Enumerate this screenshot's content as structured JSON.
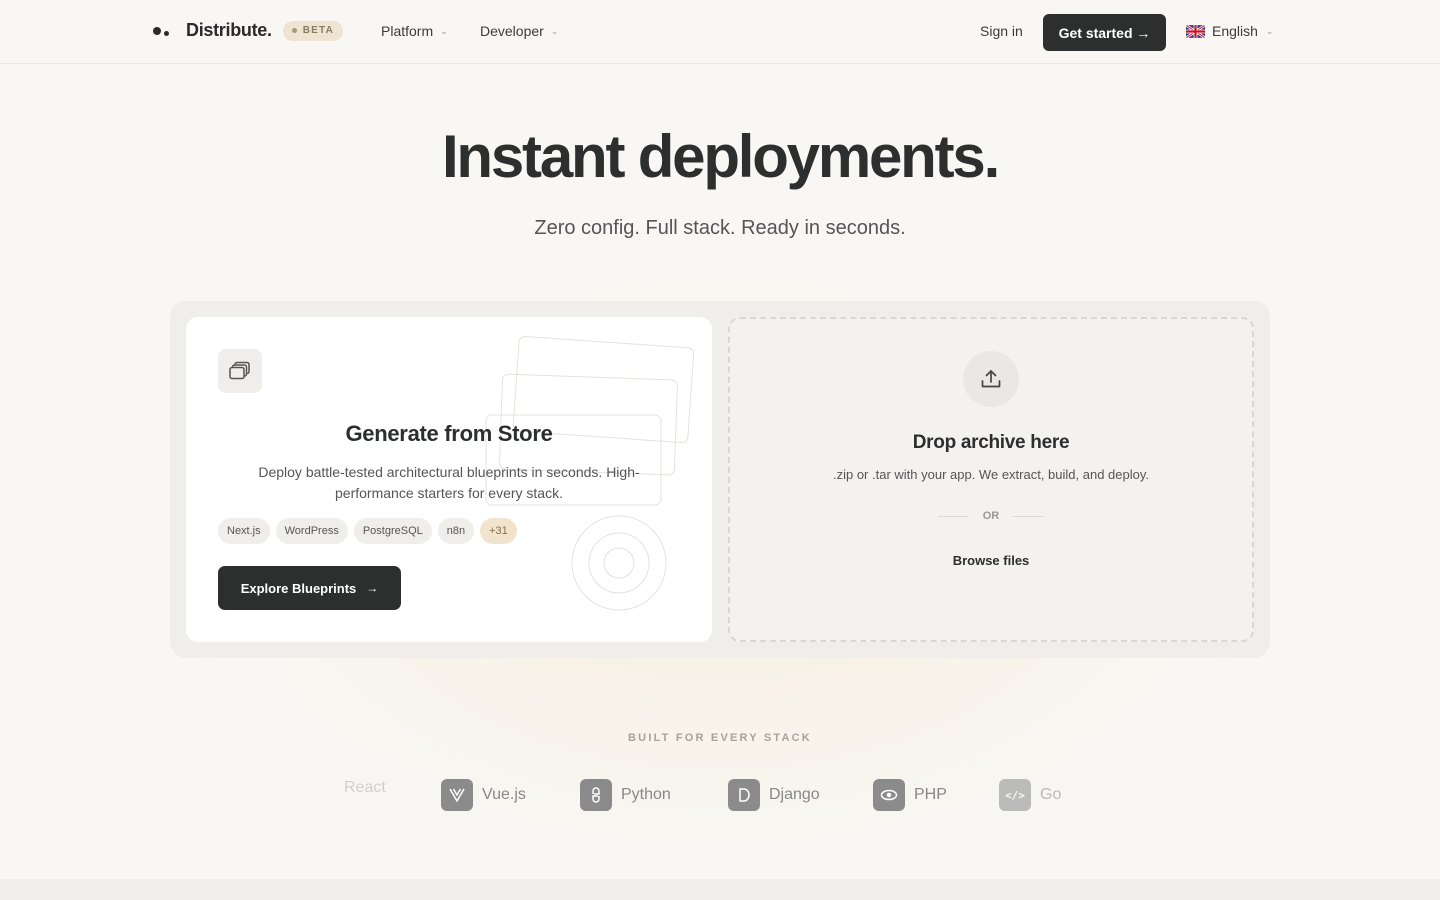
{
  "header": {
    "brand_name": "Distribute.",
    "beta_label": "BETA",
    "nav": [
      {
        "label": "Platform"
      },
      {
        "label": "Developer"
      }
    ],
    "sign_in": "Sign in",
    "get_started": "Get started →",
    "language": "English",
    "icons": {
      "logo": "distribute-logo",
      "flag": "uk-flag-icon",
      "chevron": "chevron-down-icon"
    }
  },
  "hero": {
    "title": "Instant deployments.",
    "subtitle": "Zero config. Full stack. Ready in seconds."
  },
  "store_card": {
    "title": "Generate from Store",
    "description": "Deploy battle-tested architectural blueprints in seconds. High-performance starters for every stack.",
    "tags": [
      "Next.js",
      "WordPress",
      "PostgreSQL",
      "n8n",
      "+31"
    ],
    "button": "Explore Blueprints"
  },
  "drop_card": {
    "title": "Drop archive here",
    "description": ".zip or .tar with your app. We extract, build, and deploy.",
    "or": "OR",
    "browse": "Browse files"
  },
  "stack": {
    "label": "BUILT FOR EVERY STACK",
    "items": [
      {
        "name": "React",
        "icon": "react-icon"
      },
      {
        "name": "Vue.js",
        "icon": "vue-icon"
      },
      {
        "name": "Python",
        "icon": "python-icon"
      },
      {
        "name": "Django",
        "icon": "django-icon"
      },
      {
        "name": "PHP",
        "icon": "php-icon"
      },
      {
        "name": "Go",
        "icon": "go-icon"
      }
    ]
  },
  "colors": {
    "background": "#f8f7f4",
    "primary_dark": "#2c2f2e",
    "beta_bg": "#efe4d2",
    "tag_highlight": "#f1e3cc"
  }
}
